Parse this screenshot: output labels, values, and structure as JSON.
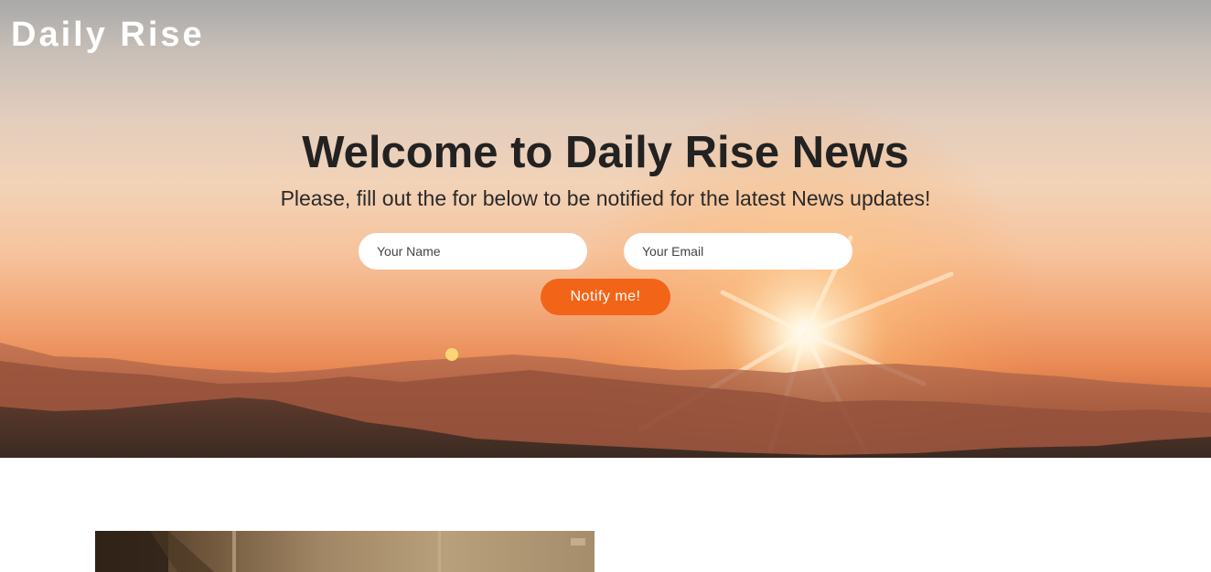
{
  "brand": "Daily Rise",
  "hero": {
    "title": "Welcome to Daily Rise News",
    "subtitle": "Please, fill out the for below to be notified for the latest News updates!",
    "name_placeholder": "Your Name",
    "email_placeholder": "Your Email",
    "button_label": "Notify me!"
  },
  "colors": {
    "button": "#f26418",
    "brand_text": "#ffffff",
    "headline_text": "#222222"
  }
}
